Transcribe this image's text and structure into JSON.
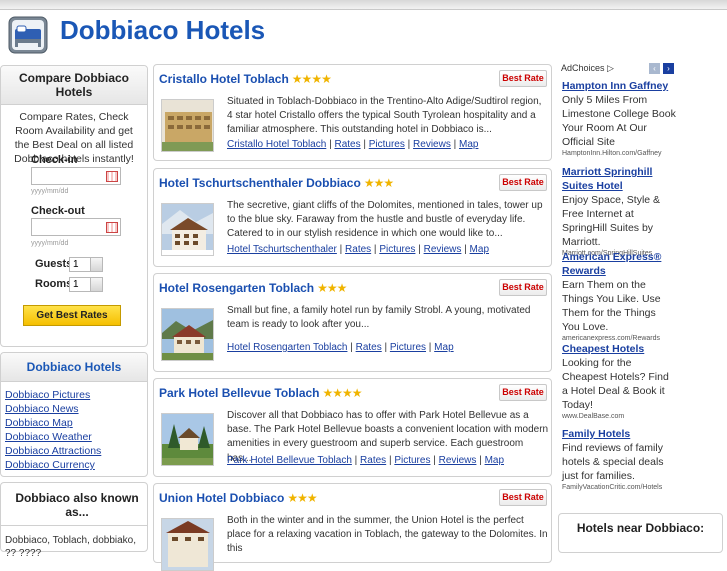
{
  "header": {
    "title": "Dobbiaco Hotels",
    "logo_icon": "hotel-bed-icon"
  },
  "compare": {
    "heading": "Compare Dobbiaco Hotels",
    "description": "Compare Rates, Check Room Availability and get the Best Deal on all listed Dobbiaco hotels instantly!",
    "checkin_label": "Check-in",
    "checkout_label": "Check-out",
    "date_hint": "yyyy/mm/dd",
    "guests_label": "Guests",
    "guests_value": "1",
    "rooms_label": "Rooms",
    "rooms_value": "1",
    "button_label": "Get Best Rates"
  },
  "links_box": {
    "heading": "Dobbiaco Hotels",
    "items": [
      "Dobbiaco Pictures",
      "Dobbiaco News",
      "Dobbiaco Map",
      "Dobbiaco Weather",
      "Dobbiaco Attractions",
      "Dobbiaco Currency"
    ]
  },
  "known_box": {
    "heading": "Dobbiaco also known as...",
    "text": "Dobbiaco, Toblach, dobbiako, ?? ????"
  },
  "best_rate_label": "Best Rate",
  "hotels": [
    {
      "name": "Cristallo Hotel Toblach",
      "stars": "★★★★",
      "description": "Situated in Toblach-Dobbiaco in the Trentino-Alto Adige/Sudtirol region, 4 star hotel Cristallo offers the typical South Tyrolean hospitality and a familiar atmosphere. This outstanding hotel in Dobbiaco is...",
      "links": [
        "Cristallo Hotel Toblach",
        "Rates",
        "Pictures",
        "Reviews",
        "Map"
      ]
    },
    {
      "name": "Hotel Tschurtschenthaler Dobbiaco",
      "stars": "★★★",
      "description": "The secretive, giant cliffs of the Dolomites, mentioned in tales, tower up to the blue sky. Faraway from the hustle and bustle of everyday life. Catered to in our stylish residence in which one would like to...",
      "links": [
        "Hotel Tschurtschenthaler",
        "Rates",
        "Pictures",
        "Reviews",
        "Map"
      ]
    },
    {
      "name": "Hotel Rosengarten Toblach",
      "stars": "★★★",
      "description": "Small but fine, a family hotel run by family Strobl. A young, motivated team is ready to look after you...",
      "links": [
        "Hotel Rosengarten Toblach",
        "Rates",
        "Pictures",
        "Map"
      ]
    },
    {
      "name": "Park Hotel Bellevue Toblach",
      "stars": "★★★★",
      "description": "Discover all that Dobbiaco has to offer with Park Hotel Bellevue as a base. The Park Hotel Bellevue boasts a convenient location with modern amenities in every guestroom and superb service. Each guestroom has...",
      "links": [
        "Park Hotel Bellevue Toblach",
        "Rates",
        "Pictures",
        "Reviews",
        "Map"
      ]
    },
    {
      "name": "Union Hotel Dobbiaco",
      "stars": "★★★",
      "description": "Both in the winter and in the summer, the Union Hotel is the perfect place for a relaxing vacation in Toblach, the gateway to the Dolomites. In this",
      "links": []
    }
  ],
  "ads": {
    "adchoices_label": "AdChoices ▷",
    "items": [
      {
        "title": "Hampton Inn Gaffney",
        "text": "Only 5 Miles From Limestone College Book Your Room At Our Official Site",
        "url": "HamptonInn.Hilton.com/Gaffney"
      },
      {
        "title": "Marriott Springhill Suites Hotel",
        "text": "Enjoy Space, Style & Free Internet at SpringHill Suites by Marriott.",
        "url": "Marriott.com/SpringHillSuites"
      },
      {
        "title": "American Express® Rewards",
        "text": "Earn Them on the Things You Like. Use Them for the Things You Love.",
        "url": "americanexpress.com/Rewards"
      },
      {
        "title": "Cheapest Hotels",
        "text": "Looking for the Cheapest Hotels? Find a Hotel Deal & Book it Today!",
        "url": "www.DealBase.com"
      },
      {
        "title": "Family Hotels",
        "text": "Find reviews of family hotels & special deals just for families.",
        "url": "FamilyVacationCritic.com/Hotels"
      }
    ]
  },
  "near_box": {
    "heading": "Hotels near Dobbiaco:"
  }
}
